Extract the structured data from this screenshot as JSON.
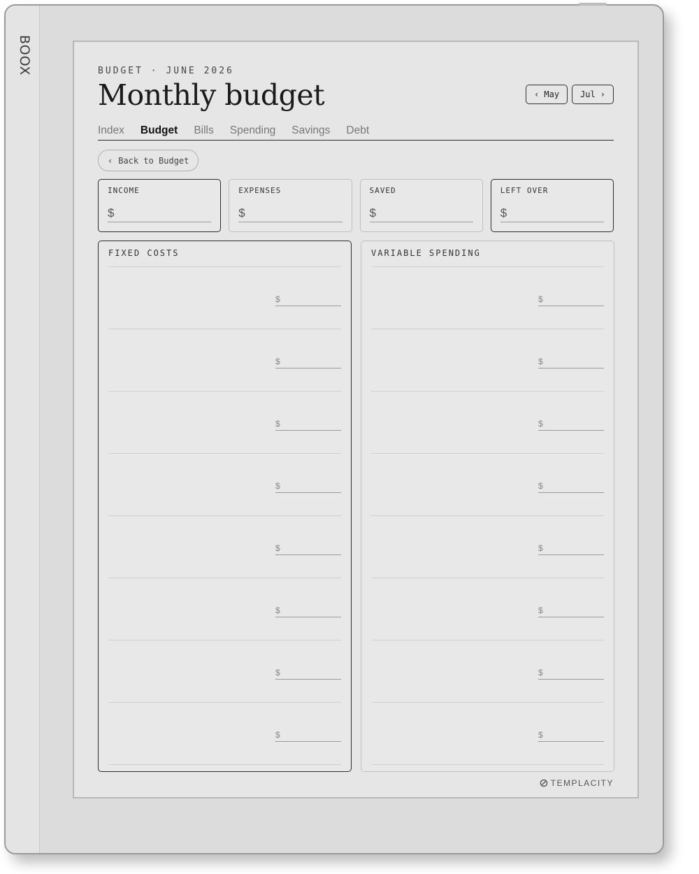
{
  "device": {
    "brand": "BOOX"
  },
  "header": {
    "eyebrow": "BUDGET · JUNE 2026",
    "title": "Monthly budget"
  },
  "month_nav": {
    "prev_label": "May",
    "next_label": "Jul",
    "prev_icon": "chevron-left-icon",
    "next_icon": "chevron-right-icon"
  },
  "tabs": [
    {
      "label": "Index",
      "active": false
    },
    {
      "label": "Budget",
      "active": true
    },
    {
      "label": "Bills",
      "active": false
    },
    {
      "label": "Spending",
      "active": false
    },
    {
      "label": "Savings",
      "active": false
    },
    {
      "label": "Debt",
      "active": false
    }
  ],
  "back_button": {
    "label": "Back to Budget"
  },
  "summary": [
    {
      "label": "INCOME",
      "currency": "$"
    },
    {
      "label": "EXPENSES",
      "currency": "$"
    },
    {
      "label": "SAVED",
      "currency": "$"
    },
    {
      "label": "LEFT OVER",
      "currency": "$"
    }
  ],
  "fixed_costs": {
    "title": "FIXED COSTS",
    "currency": "$",
    "row_count": 8
  },
  "variable_spending": {
    "title": "VARIABLE SPENDING",
    "currency": "$",
    "row_count": 8
  },
  "footer": {
    "logo_text": "TEMPLACITY"
  }
}
